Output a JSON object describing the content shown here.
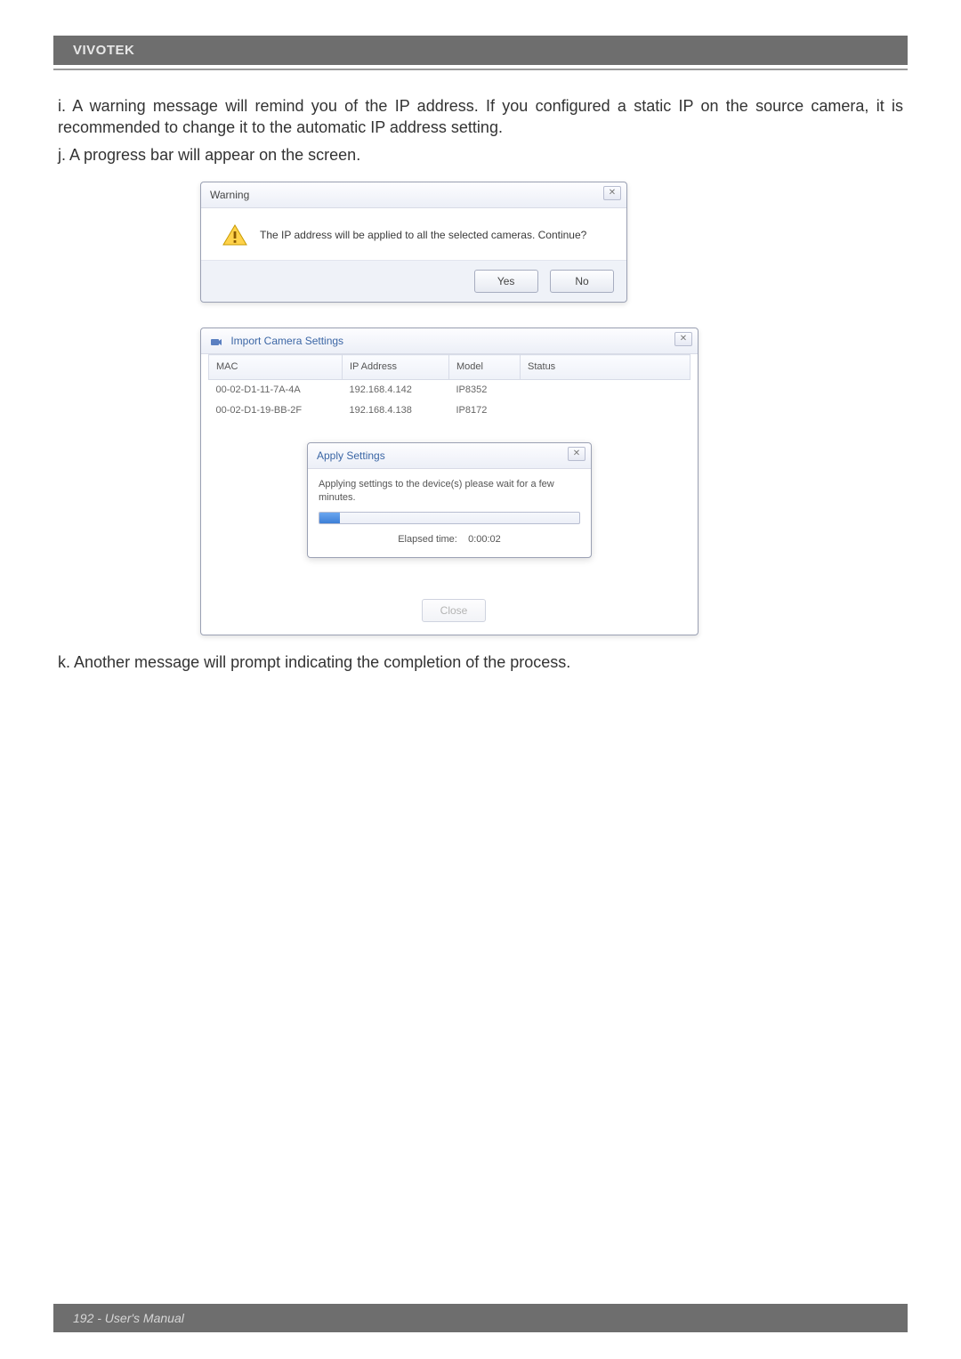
{
  "header": {
    "brand": "VIVOTEK"
  },
  "body": {
    "item_i_label": "i. ",
    "item_i_text": "A warning message will remind you of the IP address. If you configured a static IP on the source camera, it is recommended to change it to the automatic IP address setting.",
    "item_j_label": "j. ",
    "item_j_text": "A progress bar will appear on the screen.",
    "item_k_label": "k. ",
    "item_k_text": "Another message will prompt indicating the completion of the process."
  },
  "warning_dialog": {
    "title": "Warning",
    "message": "The IP address will be applied to all the selected cameras. Continue?",
    "yes": "Yes",
    "no": "No"
  },
  "import_dialog": {
    "title": "Import Camera Settings",
    "columns": {
      "mac": "MAC",
      "ip": "IP Address",
      "model": "Model",
      "status": "Status"
    },
    "rows": [
      {
        "mac": "00-02-D1-11-7A-4A",
        "ip": "192.168.4.142",
        "model": "IP8352",
        "status": ""
      },
      {
        "mac": "00-02-D1-19-BB-2F",
        "ip": "192.168.4.138",
        "model": "IP8172",
        "status": ""
      }
    ],
    "apply": {
      "title": "Apply Settings",
      "message": "Applying settings to the device(s) please wait for a few minutes.",
      "elapsed_label": "Elapsed time:",
      "elapsed_value": "0:00:02"
    },
    "close": "Close"
  },
  "footer": {
    "text": "192 - User's Manual"
  }
}
